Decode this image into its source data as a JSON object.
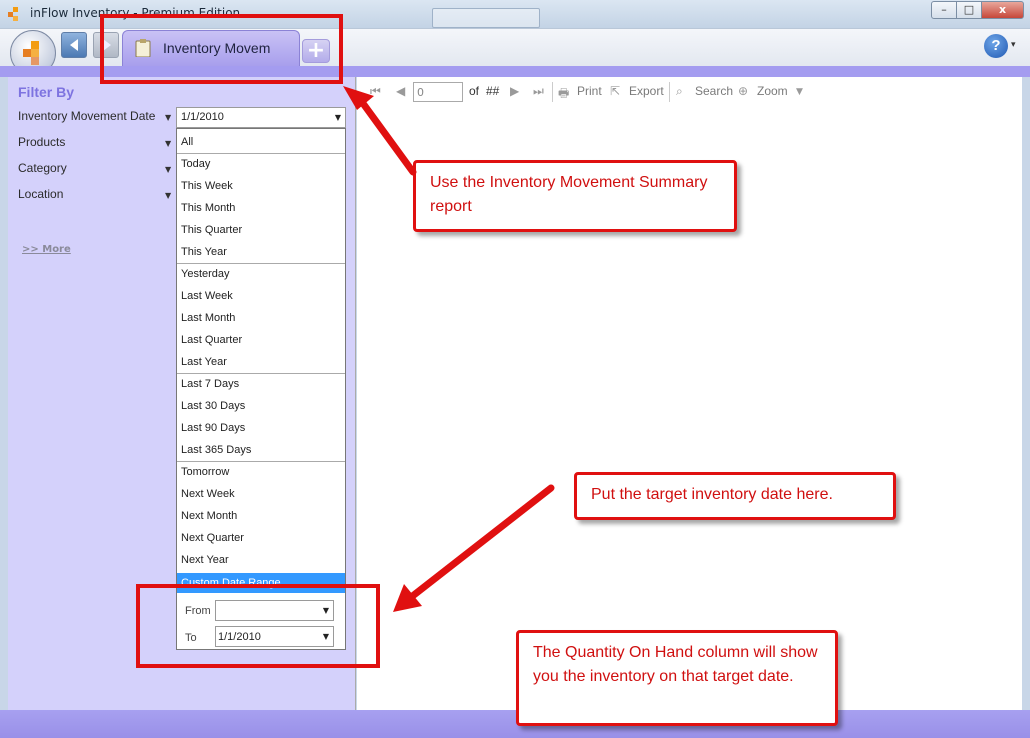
{
  "window": {
    "title": "inFlow Inventory - Premium Edition",
    "controls": {
      "minimize": "–",
      "maximize": "□",
      "close": "x"
    }
  },
  "tabbar": {
    "active_tab": "Inventory Movem",
    "add_tab": "+",
    "help": "?",
    "help_dropdown": "▾"
  },
  "filter": {
    "title": "Filter By",
    "fields": [
      {
        "label": "Inventory Movement Date"
      },
      {
        "label": "Products"
      },
      {
        "label": "Category"
      },
      {
        "label": "Location"
      }
    ],
    "more_link": ">> More",
    "date_value": "1/1/2010",
    "options": [
      "All",
      "Today",
      "This Week",
      "This Month",
      "This Quarter",
      "This Year",
      "Yesterday",
      "Last Week",
      "Last Month",
      "Last Quarter",
      "Last Year",
      "Last 7 Days",
      "Last 30 Days",
      "Last 90 Days",
      "Last 365 Days",
      "Tomorrow",
      "Next Week",
      "Next Month",
      "Next Quarter",
      "Next Year"
    ],
    "selected_option": "Custom Date Range",
    "range": {
      "from_label": "From",
      "from_value": "",
      "to_label": "To",
      "to_value": "1/1/2010"
    }
  },
  "report_toolbar": {
    "page_value": "0",
    "of_label": "of",
    "total_pages": "##",
    "print": "Print",
    "export": "Export",
    "search": "Search",
    "zoom": "Zoom"
  },
  "callouts": {
    "tab_hint": "Use the Inventory Movement Summary report",
    "date_hint": "Put the target inventory date here.",
    "qty_hint": "The Quantity On Hand column will show you the inventory on that target date."
  },
  "colors": {
    "accent_purple": "#a49cf0",
    "panel_lavender": "#d4d1fb",
    "annotation_red": "#e01010",
    "selection_blue": "#3399ff"
  }
}
